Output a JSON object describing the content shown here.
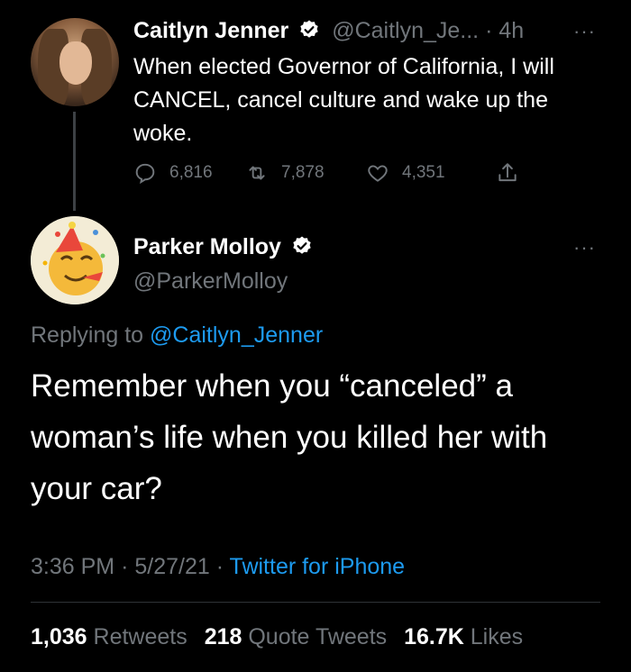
{
  "parent_tweet": {
    "author_name": "Caitlyn Jenner",
    "handle": "@Caitlyn_Je...",
    "time": "· 4h",
    "more": "···",
    "text": "When elected Governor of California, I will CANCEL, cancel culture and wake up the woke.",
    "actions": {
      "replies": "6,816",
      "retweets": "7,878",
      "likes": "4,351"
    }
  },
  "main_tweet": {
    "author_name": "Parker Molloy",
    "handle": "@ParkerMolloy",
    "more": "···",
    "replying_prefix": "Replying to",
    "replying_to": "@Caitlyn_Jenner",
    "text": "Remember when you “canceled” a woman’s life when you killed her with your car?",
    "time": "3:36 PM",
    "date": "5/27/21",
    "separator": "·",
    "source": "Twitter for iPhone",
    "stats": {
      "retweets_count": "1,036",
      "retweets_label": "Retweets",
      "quotes_count": "218",
      "quotes_label": "Quote Tweets",
      "likes_count": "16.7K",
      "likes_label": "Likes"
    }
  },
  "colors": {
    "background": "#000000",
    "text": "#ffffff",
    "muted": "#71767b",
    "link": "#1d9bf0",
    "divider": "#2f3336"
  },
  "icons": {
    "verified": "verified-badge-icon",
    "reply": "reply-icon",
    "retweet": "retweet-icon",
    "like": "heart-icon",
    "share": "share-icon",
    "more": "more-icon"
  }
}
